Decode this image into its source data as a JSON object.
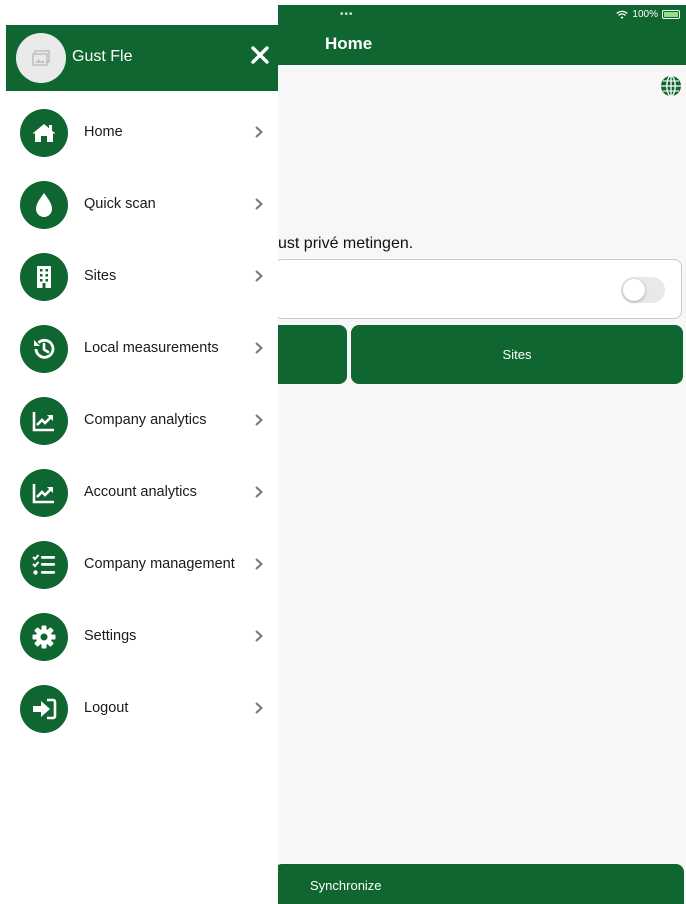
{
  "status_bar": {
    "dots": "•••",
    "battery": "100%"
  },
  "app": {
    "title": "Home",
    "notice": "ust privé metingen.",
    "tiles": {
      "sites": "Sites"
    },
    "sync_label": "Synchronize",
    "toggle": {
      "on": false
    }
  },
  "drawer": {
    "user_name": "Gust Fle",
    "items": [
      {
        "label": "Home",
        "icon": "home-icon"
      },
      {
        "label": "Quick scan",
        "icon": "drop-icon"
      },
      {
        "label": "Sites",
        "icon": "building-icon"
      },
      {
        "label": "Local measurements",
        "icon": "history-icon"
      },
      {
        "label": "Company analytics",
        "icon": "chart-icon"
      },
      {
        "label": "Account analytics",
        "icon": "chart-icon"
      },
      {
        "label": "Company management",
        "icon": "checklist-icon"
      },
      {
        "label": "Settings",
        "icon": "gear-icon"
      },
      {
        "label": "Logout",
        "icon": "logout-icon"
      }
    ]
  },
  "colors": {
    "brand": "#0f6630",
    "background": "#f7f7f7",
    "toggle_off": "#e9e9ea"
  }
}
